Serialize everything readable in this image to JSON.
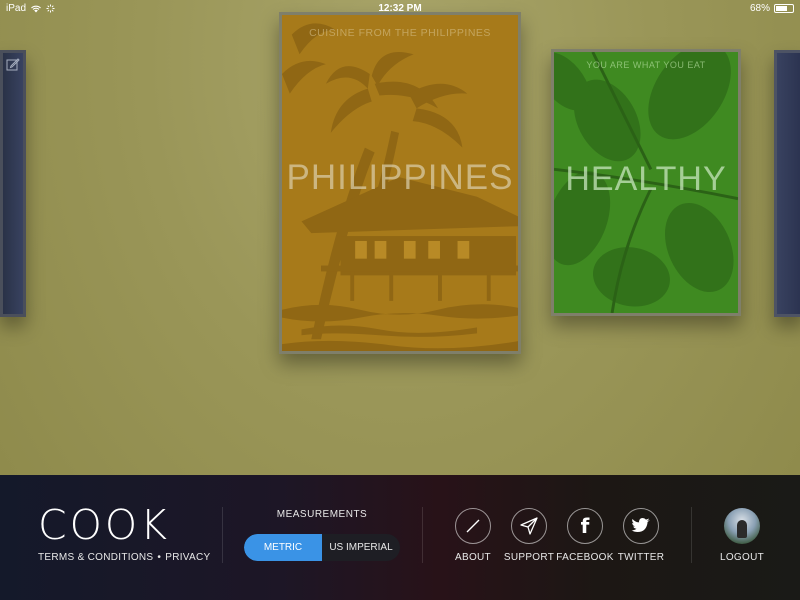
{
  "status_bar": {
    "device": "iPad",
    "time": "12:32 PM",
    "battery": "68%",
    "battery_level": 0.68
  },
  "books": {
    "philippines": {
      "subtitle": "CUISINE FROM THE PHILIPPINES",
      "title": "PHILIPPINES",
      "color": "#a77a1a"
    },
    "healthy": {
      "subtitle": "YOU ARE WHAT YOU EAT",
      "title": "HEALTHY",
      "color": "#3f8a21"
    }
  },
  "footer": {
    "brand": "COOK",
    "terms": "TERMS & CONDITIONS",
    "separator": "•",
    "privacy": "PRIVACY",
    "measurements": {
      "label": "MEASUREMENTS",
      "options": [
        "METRIC",
        "US IMPERIAL"
      ],
      "selected": "METRIC",
      "accent": "#3a93e6"
    },
    "about": "ABOUT",
    "support": "SUPPORT",
    "facebook": "FACEBOOK",
    "twitter": "TWITTER",
    "logout": "LOGOUT"
  },
  "icons": {
    "wifi": "wifi-icon",
    "activity": "activity-icon",
    "edit": "edit-icon",
    "about": "compass-icon",
    "support": "paper-plane-icon",
    "facebook": "facebook-icon",
    "twitter": "twitter-bird-icon"
  }
}
